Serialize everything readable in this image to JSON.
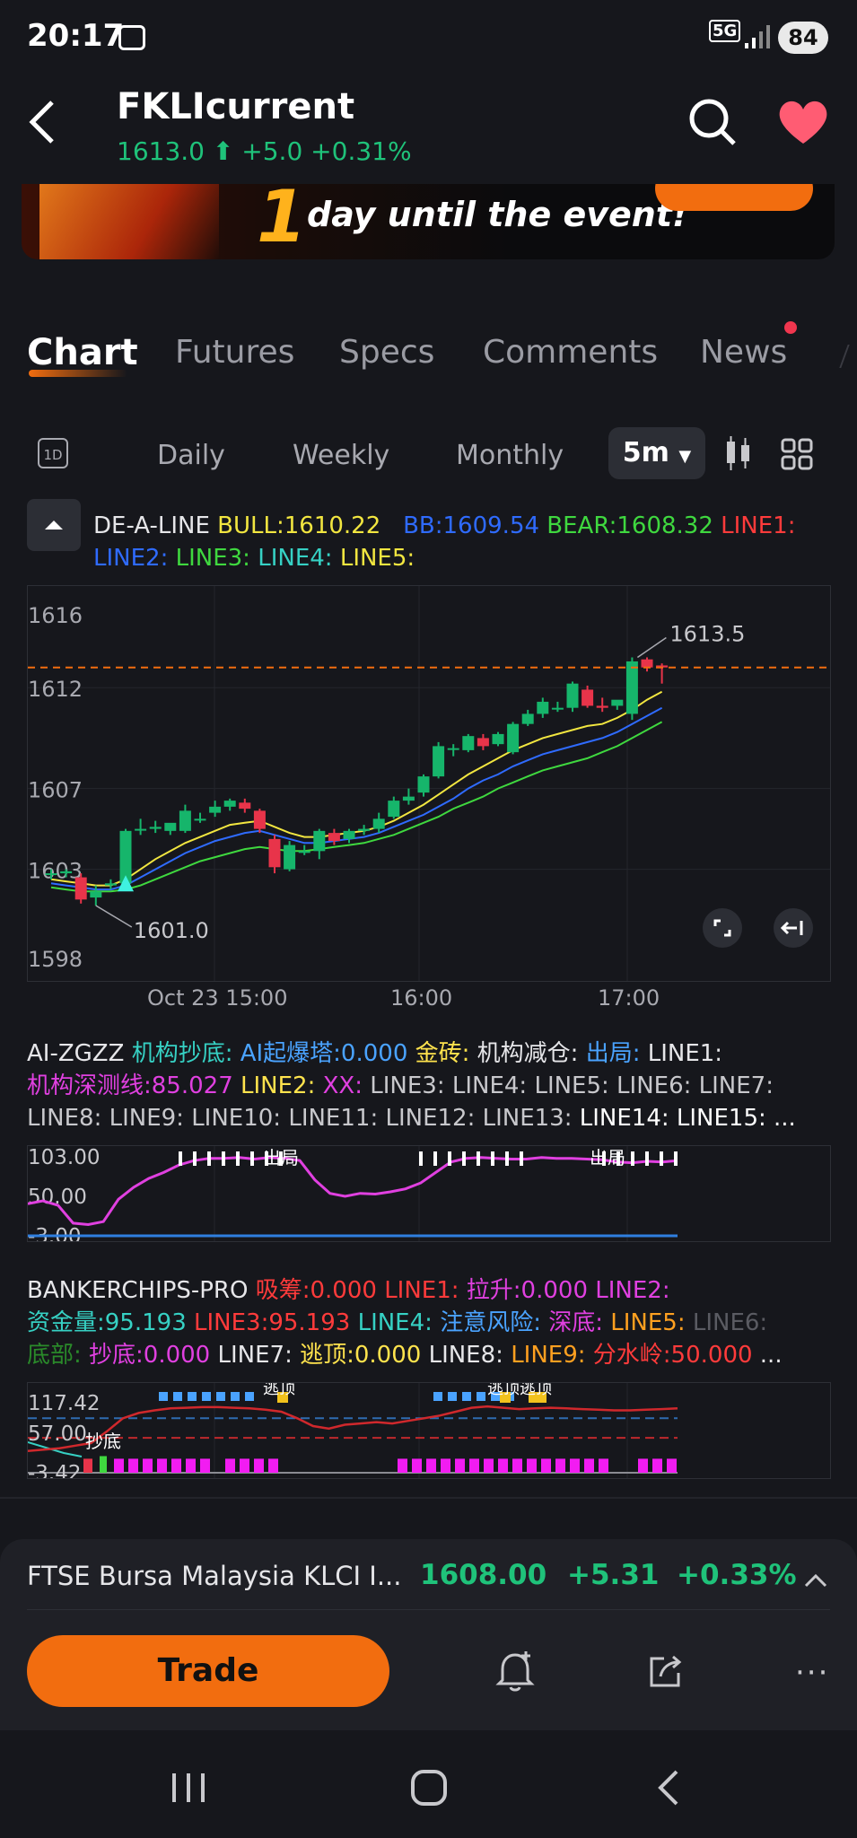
{
  "status_bar": {
    "time": "20:17",
    "network": "5G",
    "battery": "84"
  },
  "header": {
    "title": "FKLIcurrent",
    "price": "1613.0",
    "change": "+5.0",
    "change_pct": "+0.31%"
  },
  "banner": {
    "text": "day until the event!",
    "number": "1"
  },
  "tabs": [
    {
      "label": "Chart"
    },
    {
      "label": "Futures"
    },
    {
      "label": "Specs"
    },
    {
      "label": "Comments"
    },
    {
      "label": "News"
    }
  ],
  "periods": {
    "intraday_icon": "1D",
    "daily": "Daily",
    "weekly": "Weekly",
    "monthly": "Monthly",
    "selected": "5m"
  },
  "indicator_main": {
    "name": "DE-A-LINE",
    "bull": "BULL:1610.22",
    "bb": "BB:1609.54",
    "bear": "BEAR:1608.32",
    "line1": "LINE1:",
    "line2": "LINE2:",
    "line3": "LINE3:",
    "line4": "LINE4:",
    "line5": "LINE5:"
  },
  "indicator_ai": {
    "l1": [
      {
        "t": "AI-ZGZZ ",
        "c": "#e6e6e9"
      },
      {
        "t": "机构抄底: ",
        "c": "#36d1c4"
      },
      {
        "t": "AI起爆塔:0.000 ",
        "c": "#4aa3ff"
      },
      {
        "t": "金砖: ",
        "c": "#ffe34d"
      },
      {
        "t": "机构减仓: ",
        "c": "#e6e6e9"
      },
      {
        "t": "出局: ",
        "c": "#4aa3ff"
      },
      {
        "t": "LINE1:",
        "c": "#e6e6e9"
      }
    ],
    "l2": [
      {
        "t": "机构深测线:85.027 ",
        "c": "#e040e0"
      },
      {
        "t": "LINE2: ",
        "c": "#ffe34d"
      },
      {
        "t": "XX: ",
        "c": "#e040e0"
      },
      {
        "t": "LINE3: LINE4: LINE5: LINE6: LINE7:",
        "c": "#c8c8cc"
      }
    ],
    "l3": [
      {
        "t": "LINE8: LINE9: LINE10:  LINE11:   LINE12:  LINE13:  ",
        "c": "#c8c8cc"
      },
      {
        "t": "LINE14:  LINE15:  ...",
        "c": "#ffffff"
      }
    ]
  },
  "indicator_banker": {
    "l1": [
      {
        "t": "BANKERCHIPS-PRO ",
        "c": "#e6e6e9"
      },
      {
        "t": "吸筹:0.000 LINE1:  ",
        "c": "#ff3b3b"
      },
      {
        "t": "拉升:0.000 LINE2:",
        "c": "#e040e0"
      }
    ],
    "l2": [
      {
        "t": "资金量:95.193  ",
        "c": "#36d1c4"
      },
      {
        "t": "LINE3:95.193  ",
        "c": "#ff3b3b"
      },
      {
        "t": "LINE4: ",
        "c": "#36d1c4"
      },
      {
        "t": "注意风险: ",
        "c": "#4aa3ff"
      },
      {
        "t": "深底: ",
        "c": "#e040e0"
      },
      {
        "t": "LINE5: ",
        "c": "#ffa020"
      },
      {
        "t": "LINE6:",
        "c": "#5a5b62"
      }
    ],
    "l3": [
      {
        "t": "底部: ",
        "c": "#2a8a2a"
      },
      {
        "t": "抄底:0.000 ",
        "c": "#e040e0"
      },
      {
        "t": "LINE7: ",
        "c": "#e6e6e9"
      },
      {
        "t": "逃顶:0.000 ",
        "c": "#ffe34d"
      },
      {
        "t": "LINE8: ",
        "c": "#e6e6e9"
      },
      {
        "t": "LINE9: ",
        "c": "#ffa020"
      },
      {
        "t": "分水岭:50.000 ",
        "c": "#ff3b3b"
      },
      {
        "t": "...",
        "c": "#e6e6e9"
      }
    ]
  },
  "chart_data": [
    {
      "type": "candlestick",
      "y_ticks": [
        "1616",
        "1612",
        "1607",
        "1603",
        "1598"
      ],
      "ylim": [
        1598,
        1616.5
      ],
      "x_ticks": [
        "Oct 23 15:00",
        "16:00",
        "17:00"
      ],
      "current_price_line": 1613.0,
      "annotations": [
        "1613.5",
        "1601.0"
      ],
      "candles": [
        {
          "o": 1602.8,
          "h": 1603.0,
          "l": 1602.5,
          "c": 1602.8
        },
        {
          "o": 1602.8,
          "h": 1603.0,
          "l": 1602.6,
          "c": 1602.9
        },
        {
          "o": 1602.6,
          "h": 1602.8,
          "l": 1601.3,
          "c": 1601.5
        },
        {
          "o": 1601.6,
          "h": 1602.2,
          "l": 1601.2,
          "c": 1601.9
        },
        {
          "o": 1602.2,
          "h": 1602.5,
          "l": 1602.0,
          "c": 1602.3
        },
        {
          "o": 1602.3,
          "h": 1605.0,
          "l": 1602.2,
          "c": 1604.9
        },
        {
          "o": 1605.0,
          "h": 1605.5,
          "l": 1604.7,
          "c": 1605.0
        },
        {
          "o": 1605.0,
          "h": 1605.4,
          "l": 1604.8,
          "c": 1605.1
        },
        {
          "o": 1604.9,
          "h": 1605.2,
          "l": 1604.7,
          "c": 1605.3
        },
        {
          "o": 1604.9,
          "h": 1606.2,
          "l": 1604.8,
          "c": 1605.9
        },
        {
          "o": 1605.5,
          "h": 1605.8,
          "l": 1605.3,
          "c": 1605.5
        },
        {
          "o": 1605.8,
          "h": 1606.4,
          "l": 1605.6,
          "c": 1606.1
        },
        {
          "o": 1606.1,
          "h": 1606.5,
          "l": 1605.9,
          "c": 1606.4
        },
        {
          "o": 1606.3,
          "h": 1606.5,
          "l": 1605.8,
          "c": 1606.0
        },
        {
          "o": 1605.9,
          "h": 1606.0,
          "l": 1604.8,
          "c": 1605.0
        },
        {
          "o": 1604.5,
          "h": 1604.7,
          "l": 1602.8,
          "c": 1603.1
        },
        {
          "o": 1603.0,
          "h": 1604.4,
          "l": 1602.9,
          "c": 1604.2
        },
        {
          "o": 1603.9,
          "h": 1604.2,
          "l": 1603.7,
          "c": 1603.9
        },
        {
          "o": 1603.9,
          "h": 1605.0,
          "l": 1603.5,
          "c": 1604.9
        },
        {
          "o": 1604.8,
          "h": 1605.0,
          "l": 1604.2,
          "c": 1604.4
        },
        {
          "o": 1604.5,
          "h": 1605.0,
          "l": 1604.3,
          "c": 1604.9
        },
        {
          "o": 1604.9,
          "h": 1605.2,
          "l": 1604.7,
          "c": 1605.0
        },
        {
          "o": 1605.0,
          "h": 1605.8,
          "l": 1604.8,
          "c": 1605.5
        },
        {
          "o": 1605.6,
          "h": 1606.6,
          "l": 1605.5,
          "c": 1606.4
        },
        {
          "o": 1606.4,
          "h": 1607.0,
          "l": 1606.2,
          "c": 1606.6
        },
        {
          "o": 1606.8,
          "h": 1607.7,
          "l": 1606.6,
          "c": 1607.6
        },
        {
          "o": 1607.6,
          "h": 1609.3,
          "l": 1607.5,
          "c": 1609.1
        },
        {
          "o": 1609.0,
          "h": 1609.2,
          "l": 1608.6,
          "c": 1609.0
        },
        {
          "o": 1608.9,
          "h": 1609.7,
          "l": 1608.8,
          "c": 1609.6
        },
        {
          "o": 1609.5,
          "h": 1609.7,
          "l": 1608.9,
          "c": 1609.1
        },
        {
          "o": 1609.2,
          "h": 1609.8,
          "l": 1609.1,
          "c": 1609.7
        },
        {
          "o": 1608.8,
          "h": 1610.3,
          "l": 1608.7,
          "c": 1610.2
        },
        {
          "o": 1610.2,
          "h": 1610.9,
          "l": 1610.1,
          "c": 1610.7
        },
        {
          "o": 1610.7,
          "h": 1611.5,
          "l": 1610.5,
          "c": 1611.3
        },
        {
          "o": 1611.0,
          "h": 1611.3,
          "l": 1610.8,
          "c": 1611.0
        },
        {
          "o": 1611.0,
          "h": 1612.3,
          "l": 1610.8,
          "c": 1612.2
        },
        {
          "o": 1611.9,
          "h": 1612.1,
          "l": 1611.0,
          "c": 1611.1
        },
        {
          "o": 1611.1,
          "h": 1611.5,
          "l": 1610.8,
          "c": 1611.0
        },
        {
          "o": 1611.1,
          "h": 1611.3,
          "l": 1610.9,
          "c": 1611.4
        },
        {
          "o": 1610.7,
          "h": 1613.5,
          "l": 1610.4,
          "c": 1613.3
        },
        {
          "o": 1613.4,
          "h": 1613.5,
          "l": 1612.8,
          "c": 1613.0
        },
        {
          "o": 1613.1,
          "h": 1613.2,
          "l": 1612.2,
          "c": 1613.0
        }
      ],
      "bull_line": [
        1602.5,
        1602.4,
        1602.3,
        1602.2,
        1602.2,
        1602.5,
        1603.0,
        1603.5,
        1603.9,
        1604.3,
        1604.6,
        1604.9,
        1605.2,
        1605.3,
        1605.4,
        1605.1,
        1604.8,
        1604.6,
        1604.6,
        1604.7,
        1604.8,
        1604.9,
        1605.1,
        1605.4,
        1605.8,
        1606.2,
        1606.7,
        1607.2,
        1607.7,
        1608.1,
        1608.5,
        1608.9,
        1609.2,
        1609.5,
        1609.7,
        1609.9,
        1610.1,
        1610.2,
        1610.5,
        1610.9,
        1611.4,
        1611.8
      ],
      "bb_line": [
        1602.3,
        1602.2,
        1602.1,
        1602.0,
        1602.0,
        1602.2,
        1602.6,
        1603.0,
        1603.4,
        1603.8,
        1604.1,
        1604.4,
        1604.6,
        1604.8,
        1604.9,
        1604.7,
        1604.5,
        1604.3,
        1604.3,
        1604.4,
        1604.5,
        1604.6,
        1604.8,
        1605.1,
        1605.4,
        1605.7,
        1606.1,
        1606.5,
        1607.0,
        1607.4,
        1607.7,
        1608.1,
        1608.4,
        1608.7,
        1608.9,
        1609.1,
        1609.3,
        1609.5,
        1609.8,
        1610.2,
        1610.6,
        1611.0
      ],
      "bear_line": [
        1602.1,
        1602.0,
        1601.9,
        1601.9,
        1601.9,
        1602.0,
        1602.2,
        1602.5,
        1602.8,
        1603.1,
        1603.4,
        1603.6,
        1603.8,
        1604.0,
        1604.1,
        1604.0,
        1603.9,
        1603.9,
        1604.0,
        1604.1,
        1604.2,
        1604.3,
        1604.5,
        1604.7,
        1605.0,
        1605.3,
        1605.6,
        1606.0,
        1606.3,
        1606.6,
        1607.0,
        1607.3,
        1607.6,
        1607.9,
        1608.1,
        1608.3,
        1608.5,
        1608.8,
        1609.1,
        1609.5,
        1609.9,
        1610.3
      ]
    },
    {
      "type": "line",
      "y_ticks": [
        "103.00",
        "50.00",
        "-3.00"
      ],
      "ylim": [
        -3,
        103
      ],
      "labels": [
        "出局",
        "出局"
      ],
      "series": [
        {
          "values": [
            40,
            44,
            38,
            14,
            12,
            16,
            46,
            62,
            74,
            82,
            92,
            98,
            101,
            101,
            102,
            100,
            102,
            101,
            98,
            72,
            54,
            50,
            54,
            53,
            56,
            60,
            68,
            82,
            96,
            101,
            102,
            101,
            100,
            100,
            102,
            101,
            101,
            100,
            99,
            96,
            95,
            97,
            96,
            98
          ]
        }
      ]
    },
    {
      "type": "line",
      "y_ticks": [
        "117.42",
        "57.00",
        "-3.42"
      ],
      "ylim": [
        -3.42,
        117.42
      ],
      "labels": [
        "抄底",
        "逃顶",
        "逃顶逃顶"
      ],
      "series": [
        {
          "values": [
            30,
            32,
            34,
            38,
            42,
            60,
            80,
            88,
            92,
            95,
            96,
            97,
            97,
            96,
            95,
            93,
            90,
            80,
            68,
            64,
            70,
            72,
            74,
            72,
            76,
            80,
            84,
            90,
            96,
            98,
            96,
            94,
            95,
            96,
            95,
            94,
            93,
            92,
            92,
            93,
            94,
            95
          ]
        }
      ]
    }
  ],
  "bottom": {
    "instrument": "FTSE Bursa Malaysia KLCI I...",
    "price": "1608.00",
    "change": "+5.31",
    "change_pct": "+0.33%",
    "trade_label": "Trade"
  },
  "colors": {
    "up": "#16b56b",
    "down": "#e8344a",
    "bull": "#f2e640",
    "bb": "#2f6bff",
    "bear": "#3fd83f",
    "accent": "#f26d0f"
  }
}
